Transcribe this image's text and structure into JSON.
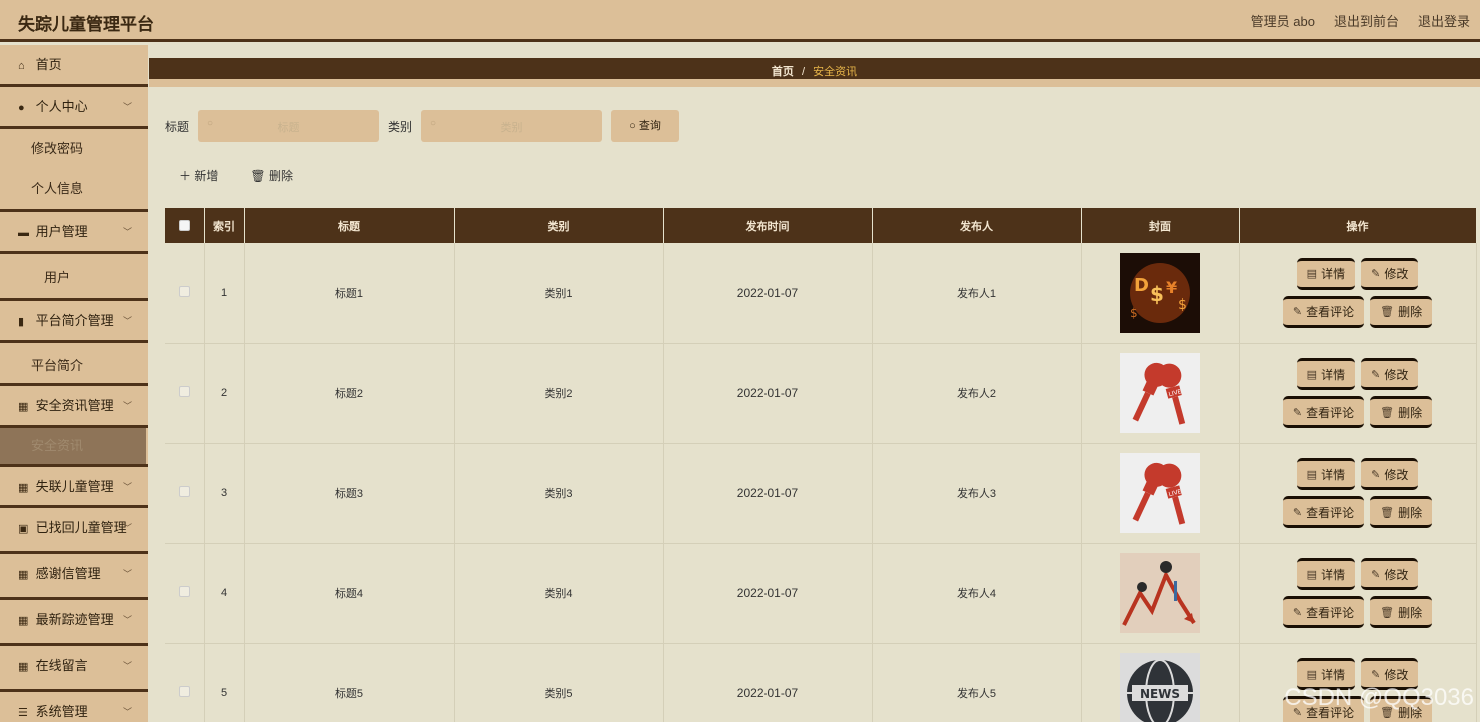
{
  "app": {
    "title": "失踪儿童管理平台",
    "user_label": "管理员 abo",
    "to_front_label": "退出到前台",
    "logout_label": "退出登录"
  },
  "sidebar": {
    "home": "首页",
    "personal": "个人中心",
    "change_password": "修改密码",
    "personal_info": "个人信息",
    "user_mgmt": "用户管理",
    "user": "用户",
    "platform_mgmt": "平台简介管理",
    "platform_intro": "平台简介",
    "news_mgmt": "安全资讯管理",
    "news": "安全资讯",
    "missing_mgmt": "失联儿童管理",
    "found_mgmt": "已找回儿童管理",
    "thanks_mgmt": "感谢信管理",
    "trace_mgmt": "最新踪迹管理",
    "message": "在线留言",
    "system_mgmt": "系统管理"
  },
  "breadcrumb": {
    "home": "首页",
    "separator": "/",
    "current": "安全资讯"
  },
  "search": {
    "title_label": "标题",
    "title_placeholder": "标题",
    "category_label": "类别",
    "category_placeholder": "类别",
    "query_label": "查询"
  },
  "actions": {
    "add_label": "新增",
    "delete_label": "删除"
  },
  "table": {
    "headers": {
      "index": "索引",
      "title": "标题",
      "category": "类别",
      "publish_time": "发布时间",
      "publisher": "发布人",
      "cover": "封面",
      "operations": "操作"
    },
    "rows": [
      {
        "index": "1",
        "title": "标题1",
        "category": "类别1",
        "date": "2022-01-07",
        "publisher": "发布人1",
        "cover": "money-collage"
      },
      {
        "index": "2",
        "title": "标题2",
        "category": "类别2",
        "date": "2022-01-07",
        "publisher": "发布人2",
        "cover": "news-microphones"
      },
      {
        "index": "3",
        "title": "标题3",
        "category": "类别3",
        "date": "2022-01-07",
        "publisher": "发布人3",
        "cover": "news-microphones"
      },
      {
        "index": "4",
        "title": "标题4",
        "category": "类别4",
        "date": "2022-01-07",
        "publisher": "发布人4",
        "cover": "falling-chart"
      },
      {
        "index": "5",
        "title": "标题5",
        "category": "类别5",
        "date": "2022-01-07",
        "publisher": "发布人5",
        "cover": "news-globe"
      }
    ],
    "op_labels": {
      "detail": "详情",
      "edit": "修改",
      "comments": "查看评论",
      "delete": "删除"
    }
  },
  "watermark": "CSDN @QQ3036",
  "colors": {
    "header_bg": "#dcbf98",
    "dark_brown": "#4d3219",
    "content_bg": "#e5e1cc",
    "accent_text": "#e8b64a"
  }
}
